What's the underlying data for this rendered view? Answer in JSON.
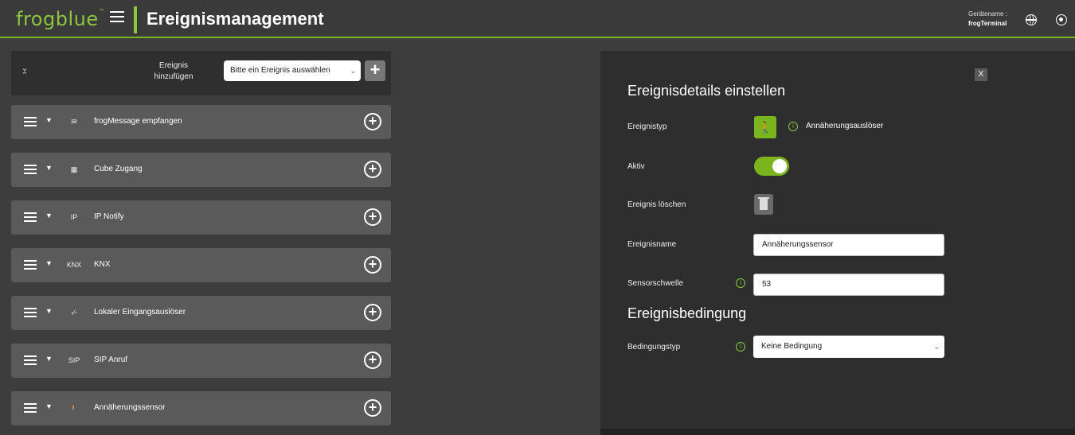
{
  "header": {
    "logo": "frogblue",
    "logo_tm": "™",
    "title": "Ereignismanagement",
    "device_label": "Gerätename :",
    "device_value": "frogTerminal"
  },
  "add_event": {
    "label": "Ereignis hinzufügen",
    "select_value": "Bitte ein Ereignis auswählen",
    "plus": "+"
  },
  "events": [
    {
      "label": "frogMessage empfangen",
      "icon": "frog-message-icon",
      "glyph": "✉"
    },
    {
      "label": "Cube Zugang",
      "icon": "keypad-icon",
      "glyph": "▦"
    },
    {
      "label": "IP Notify",
      "icon": "ip-mail-icon",
      "glyph": "IP"
    },
    {
      "label": "KNX",
      "icon": "knx-icon",
      "glyph": "KNX"
    },
    {
      "label": "Lokaler Eingangsauslöser",
      "icon": "switch-icon",
      "glyph": "-⁄-"
    },
    {
      "label": "SIP Anruf",
      "icon": "sip-icon",
      "glyph": "SIP"
    },
    {
      "label": "Annäherungssensor",
      "icon": "walking-person-icon",
      "glyph": "🚶"
    }
  ],
  "detail": {
    "close": "X",
    "heading": "Ereignisdetails einstellen",
    "type_label": "Ereignistyp",
    "type_value": "Annäherungsauslöser",
    "active_label": "Aktiv",
    "active": true,
    "delete_label": "Ereignis löschen",
    "name_label": "Ereignisname",
    "name_value": "Annäherungssensor",
    "threshold_label": "Sensorschwelle",
    "threshold_value": "53",
    "condition_heading": "Ereignisbedingung",
    "condition_label": "Bedingungstyp",
    "condition_value": "Keine Bedingung",
    "info_glyph": "i"
  },
  "colors": {
    "accent": "#7ab51d",
    "background": "#3d3d3d",
    "panel": "#2e2e2e",
    "row": "#5a5a5a"
  }
}
